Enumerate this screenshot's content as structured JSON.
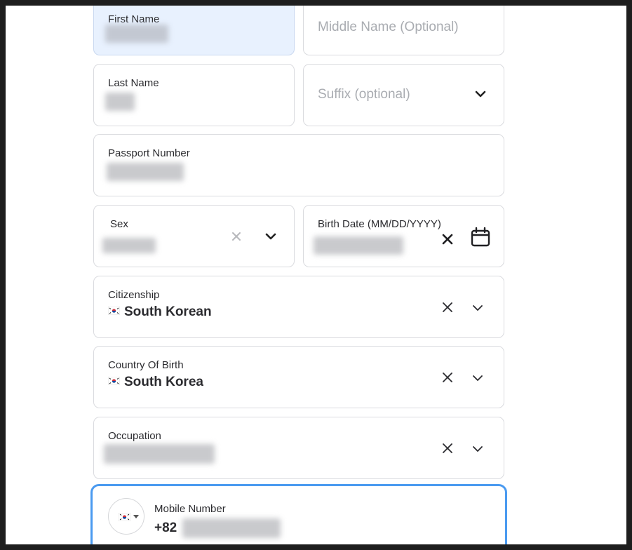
{
  "form": {
    "first_name": {
      "label": "First Name"
    },
    "middle_name": {
      "placeholder": "Middle Name (Optional)"
    },
    "last_name": {
      "label": "Last Name"
    },
    "suffix": {
      "placeholder": "Suffix (optional)",
      "icon": "chevron-down-icon"
    },
    "passport_number": {
      "label": "Passport Number"
    },
    "sex": {
      "label": "Sex",
      "icons": [
        "clear-icon",
        "chevron-down-icon"
      ]
    },
    "birth_date": {
      "label": "Birth Date (MM/DD/YYYY)",
      "icons": [
        "clear-icon",
        "calendar-icon"
      ]
    },
    "citizenship": {
      "label": "Citizenship",
      "value": "South Korean",
      "flag": "south-korea-flag-icon"
    },
    "country_of_birth": {
      "label": "Country Of Birth",
      "value": "South Korea",
      "flag": "south-korea-flag-icon"
    },
    "occupation": {
      "label": "Occupation"
    },
    "mobile_number": {
      "label": "Mobile Number",
      "dial_code": "+82",
      "flag": "south-korea-flag-icon"
    }
  },
  "colors": {
    "focus": "#4a9af0",
    "active_field": "#e8f1fe",
    "border": "#dadbdf",
    "text": "#2b2b2f",
    "placeholder": "#a9acb1"
  }
}
